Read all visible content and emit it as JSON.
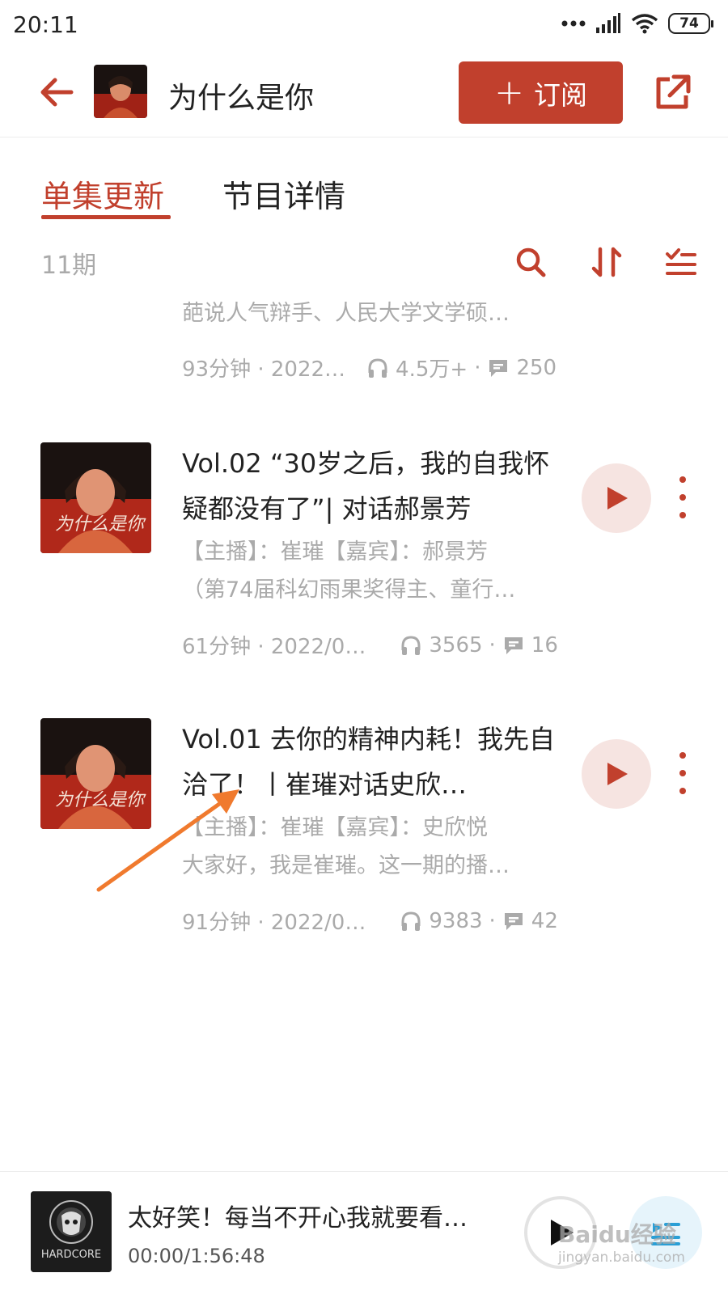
{
  "status": {
    "time": "20:11",
    "battery": "74"
  },
  "header": {
    "title": "为什么是你",
    "subscribe_label": "订阅"
  },
  "tabs": [
    {
      "label": "单集更新",
      "active": true
    },
    {
      "label": "节目详情",
      "active": false
    }
  ],
  "toolbar": {
    "episode_count": "11期"
  },
  "partial_episode": {
    "desc_line_2": "葩说人气辩手、人民大学文学硕…",
    "meta_duration_date": "93分钟 · 2022…",
    "plays": "4.5万+",
    "comments": "250"
  },
  "episodes": [
    {
      "title": "Vol.02 “30岁之后，我的自我怀疑都没有了”| 对话郝景芳",
      "desc_line_1": "【主播】：崔璀【嘉宾】：郝景芳",
      "desc_line_2": "（第74届科幻雨果奖得主、童行…",
      "meta_duration_date": "61分钟 · 2022/0…",
      "plays": "3565",
      "comments": "16"
    },
    {
      "title": "Vol.01 去你的精神内耗！我先自洽了！丨崔璀对话史欣…",
      "desc_line_1": "【主播】：崔璀【嘉宾】：史欣悦",
      "desc_line_2": "大家好，我是崔璀。这一期的播…",
      "meta_duration_date": "91分钟 · 2022/0…",
      "plays": "9383",
      "comments": "42"
    }
  ],
  "player": {
    "title": "太好笑！每当不开心我就要看…",
    "time": "00:00/1:56:48",
    "cover_text": "HARDCORE"
  },
  "watermark": {
    "brand": "Baidu经验",
    "url": "jingyan.baidu.com"
  },
  "colors": {
    "accent": "#c1402d",
    "annotation_arrow": "#f07a2e"
  }
}
